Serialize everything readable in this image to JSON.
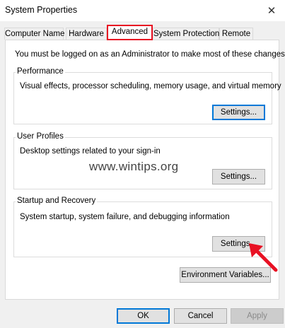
{
  "window": {
    "title": "System Properties",
    "close_glyph": "✕"
  },
  "tabs": [
    {
      "label": "Computer Name",
      "active": false
    },
    {
      "label": "Hardware",
      "active": false
    },
    {
      "label": "Advanced",
      "active": true
    },
    {
      "label": "System Protection",
      "active": false
    },
    {
      "label": "Remote",
      "active": false
    }
  ],
  "advanced": {
    "intro": "You must be logged on as an Administrator to make most of these changes.",
    "performance": {
      "title": "Performance",
      "description": "Visual effects, processor scheduling, memory usage, and virtual memory",
      "button": "Settings..."
    },
    "user_profiles": {
      "title": "User Profiles",
      "description": "Desktop settings related to your sign-in",
      "button": "Settings..."
    },
    "startup_recovery": {
      "title": "Startup and Recovery",
      "description": "System startup, system failure, and debugging information",
      "button": "Settings..."
    },
    "env_button": "Environment Variables..."
  },
  "watermark": "www.wintips.org",
  "footer": {
    "ok": "OK",
    "cancel": "Cancel",
    "apply": "Apply"
  },
  "colors": {
    "highlight_red": "#e81123",
    "focus_blue": "#0078d7"
  },
  "icons": {
    "close": "close-icon",
    "annotation": "red-arrow-icon"
  }
}
